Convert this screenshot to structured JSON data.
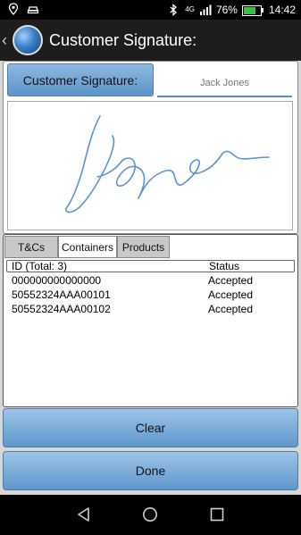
{
  "status_bar": {
    "battery_text": "76%",
    "battery_level": 0.76,
    "network_label": "4G",
    "time": "14:42"
  },
  "app_bar": {
    "title": "Customer Signature:"
  },
  "signature": {
    "label": "Customer Signature:",
    "name_value": "Jack Jones",
    "ink_color": "#5b93d6"
  },
  "tabs": [
    {
      "label": "T&Cs",
      "active": false
    },
    {
      "label": "Containers",
      "active": true
    },
    {
      "label": "Products",
      "active": false
    }
  ],
  "containers_table": {
    "columns": [
      "ID (Total: 3)",
      "Status"
    ],
    "rows": [
      {
        "id": "000000000000000",
        "status": "Accepted"
      },
      {
        "id": "50552324AAA00101",
        "status": "Accepted"
      },
      {
        "id": "50552324AAA00102",
        "status": "Accepted"
      }
    ]
  },
  "buttons": {
    "clear": "Clear",
    "done": "Done"
  },
  "colors": {
    "accent_blue": "#5f97cd",
    "app_bar": "#1d1d1d"
  }
}
